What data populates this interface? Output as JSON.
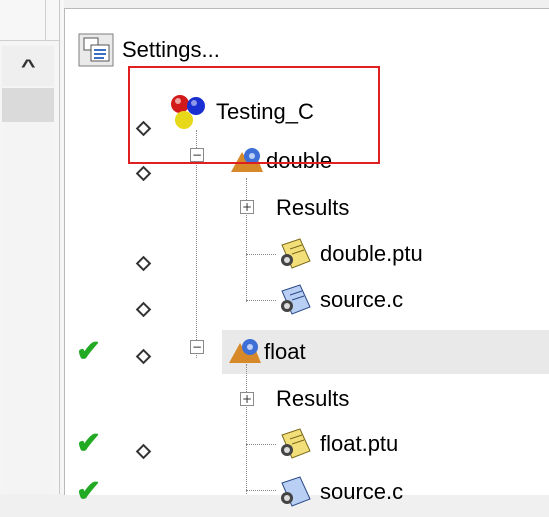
{
  "toolbar": {
    "settings_label": "Settings..."
  },
  "scrollbar": {
    "up_arrow": "^"
  },
  "tree": {
    "root": {
      "label": "Testing_C",
      "icon": "project-icon"
    },
    "nodes": [
      {
        "label": "double",
        "icon": "testnode-icon",
        "expander": "−"
      },
      {
        "label": "Results",
        "expander": "+"
      },
      {
        "label": "double.ptu",
        "icon": "ptu-file-icon"
      },
      {
        "label": "source.c",
        "icon": "c-file-icon"
      },
      {
        "label": "float",
        "icon": "testnode-icon",
        "expander": "−",
        "status": "passed"
      },
      {
        "label": "Results",
        "expander": "+"
      },
      {
        "label": "float.ptu",
        "icon": "ptu-file-icon",
        "status": "passed"
      },
      {
        "label": "source.c",
        "icon": "c-file-icon",
        "status": "passed"
      }
    ]
  },
  "colors": {
    "highlight": "#e02020",
    "check": "#22aa22",
    "selection": "#e9e9e9"
  }
}
